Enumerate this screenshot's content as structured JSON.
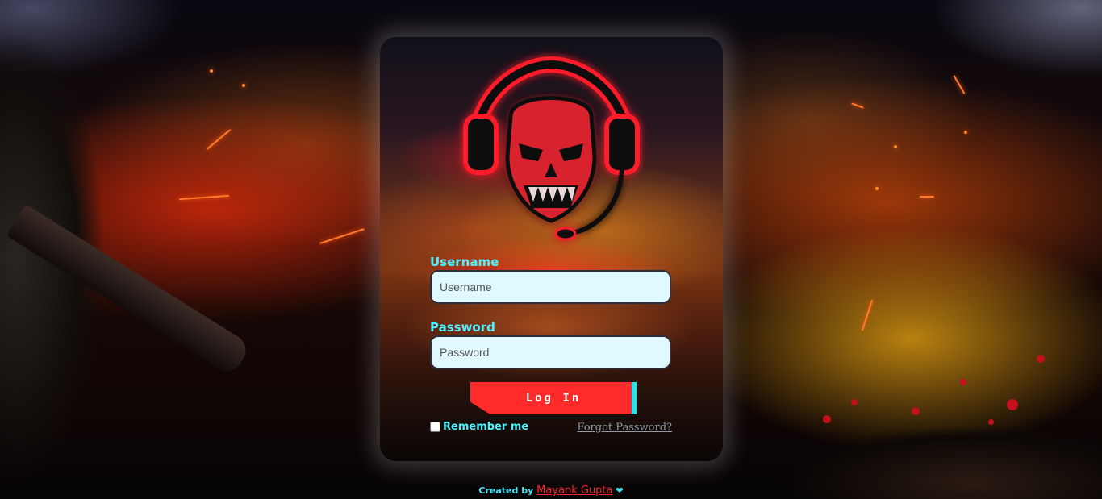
{
  "login": {
    "username_label": "Username",
    "username_placeholder": "Username",
    "username_value": "",
    "password_label": "Password",
    "password_placeholder": "Password",
    "password_value": "",
    "login_button": "Log In",
    "remember_label": "Remember me",
    "remember_checked": false,
    "forgot_link": "Forgot Password?"
  },
  "logo": {
    "icon": "skull-headset-icon"
  },
  "footer": {
    "prefix": "Created by",
    "author": "Mayank Gupta",
    "heart_icon": "heart-icon",
    "heart_glyph": "❤"
  },
  "colors": {
    "accent_cyan": "#4cf2ff",
    "button_red": "#ff2a2a",
    "input_bg": "#dff9ff"
  }
}
